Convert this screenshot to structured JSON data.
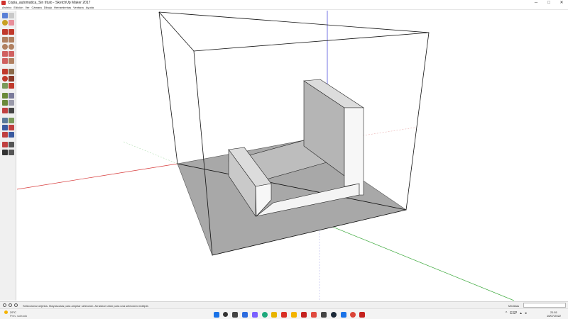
{
  "window": {
    "title": "Copia_automatica_Sin título - SketchUp Maker 2017",
    "controls": {
      "minimize": "─",
      "maximize": "□",
      "close": "✕"
    }
  },
  "menu": {
    "items": [
      "Archivo",
      "Edición",
      "Ver",
      "Cámara",
      "Dibujo",
      "Herramientas",
      "Ventana",
      "Ayuda"
    ]
  },
  "toolbar": {
    "tools": [
      "select-icon",
      "eraser-icon",
      "paint-bucket-icon",
      "eraser-alt-icon",
      "line-icon",
      "freehand-icon",
      "rectangle-icon",
      "rotated-rectangle-icon",
      "circle-icon",
      "polygon-icon",
      "arc-icon",
      "pie-icon",
      "push-pull-icon",
      "follow-me-icon",
      "move-icon",
      "rotate-icon",
      "scale-icon",
      "offset-icon",
      "tape-measure-icon",
      "dimension-icon",
      "protractor-icon",
      "text-icon",
      "axes-icon",
      "3d-text-icon",
      "orbit-icon",
      "pan-icon",
      "zoom-icon",
      "zoom-window-icon",
      "zoom-extents-icon",
      "walk-icon",
      "position-camera-icon",
      "look-around-icon",
      "section-plane-icon",
      "footprints-icon"
    ]
  },
  "status": {
    "message": "Seleccionar objetos. Mayúsculas para ampliar selección. Arrastrar ratón para una selección múltiple.",
    "measure_label": "Medidas",
    "measure_value": ""
  },
  "taskbar": {
    "weather_temp": "29°C",
    "weather_condition": "Prev. soleado",
    "apps": [
      "windows-start-icon",
      "search-icon",
      "task-view-icon",
      "widgets-icon",
      "chat-icon",
      "edge-icon",
      "chrome-icon",
      "file-explorer-icon",
      "store-icon",
      "app-icon-red",
      "app-icon-photos",
      "app-icon-mail",
      "app-icon-calendar",
      "app-icon-sketchup",
      "steam-icon",
      "app-icon-blue",
      "chrome-profile-icon",
      "app-icon-pink",
      "sketchup-icon"
    ],
    "tray": {
      "chevron": "^",
      "lang": "ESP",
      "wifi": "wifi-icon",
      "volume": "volume-icon"
    },
    "time": "21:51",
    "date": "16/07/2022"
  },
  "colors": {
    "axis_red": "#d73a3a",
    "axis_green": "#3aa83a",
    "axis_blue": "#3a3ad7",
    "shadow": "#a8a8a8",
    "face_light": "#f7f7f7",
    "face_mid": "#c9c9c9",
    "face_dark": "#b5b5b5"
  }
}
